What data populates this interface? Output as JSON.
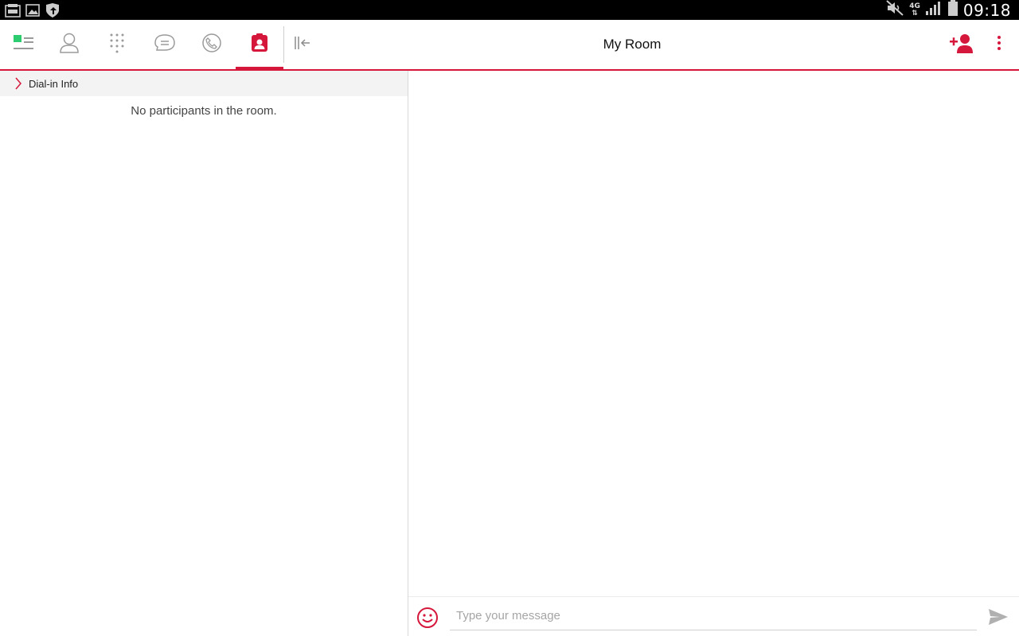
{
  "status_bar": {
    "time": "09:18",
    "network": "4G",
    "icons": [
      "wallet-icon",
      "gallery-icon",
      "shield-icon",
      "mute-icon",
      "signal-icon",
      "battery-icon"
    ]
  },
  "toolbar": {
    "title": "My Room",
    "tabs": [
      {
        "name": "presence",
        "icon": "presence-icon"
      },
      {
        "name": "contacts",
        "icon": "contact-icon"
      },
      {
        "name": "dialpad",
        "icon": "dialpad-icon"
      },
      {
        "name": "messages",
        "icon": "chat-icon"
      },
      {
        "name": "call-history",
        "icon": "call-history-icon"
      },
      {
        "name": "my-room",
        "icon": "room-icon",
        "active": true
      }
    ],
    "collapse_icon": "collapse-panel-icon",
    "add_participant_icon": "add-person-icon",
    "overflow_icon": "more-vertical-icon"
  },
  "left_panel": {
    "dialin_label": "Dial-in Info",
    "empty_message": "No participants in the room."
  },
  "composer": {
    "placeholder": "Type your message",
    "value": "",
    "emoji_icon": "emoji-icon",
    "send_icon": "send-icon"
  },
  "colors": {
    "accent": "#d6173c",
    "presence": "#2ecc71",
    "icon_gray": "#9a9a9a"
  }
}
